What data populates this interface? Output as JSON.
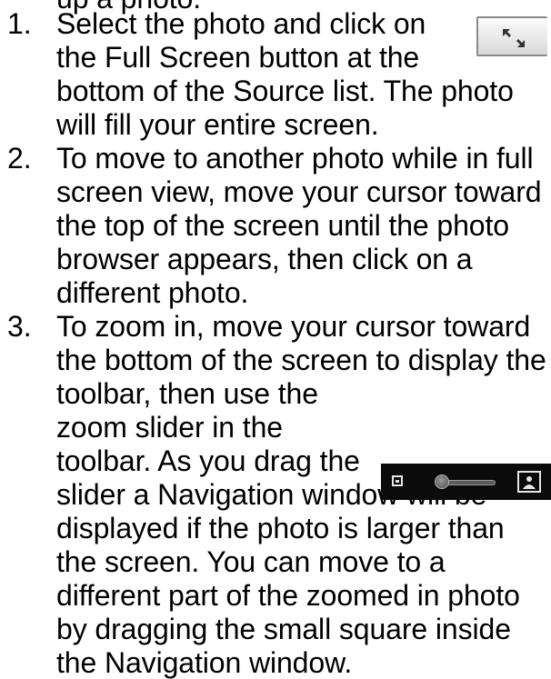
{
  "lines": {
    "l0": "up a photo.",
    "n1": "1.",
    "l1": "Select the photo and click on",
    "l2": "the Full Screen button at the",
    "l3": "bottom of the Source list. The photo",
    "l4": "will fill your entire screen.",
    "n2": "2.",
    "l5": "To move to another photo while in full",
    "l6": "screen view, move your cursor toward",
    "l7": "the top of the screen until the photo",
    "l8": "browser appears, then click on a",
    "l9": "different photo.",
    "n3": "3.",
    "l10": "To zoom in, move your cursor toward",
    "l11": "the bottom of the screen to display the",
    "l12": "toolbar, then use the",
    "l13": "zoom slider in the",
    "l14": "toolbar. As you drag the",
    "l15": "slider a Navigation window will be",
    "l16": "displayed if the photo is larger than",
    "l17": "the screen. You can move to a",
    "l18": "different part of the zoomed in photo",
    "l19": "by dragging the small square inside",
    "l20": "the Navigation window."
  },
  "icons": {
    "full_screen_button": "expand-arrows-icon",
    "zoom_slider": "zoom-slider-icon",
    "zoom_out": "small-photo-icon",
    "zoom_in": "large-photo-icon"
  },
  "colors": {
    "text": "#000000",
    "toolbar_background": "#0b0b0b"
  }
}
